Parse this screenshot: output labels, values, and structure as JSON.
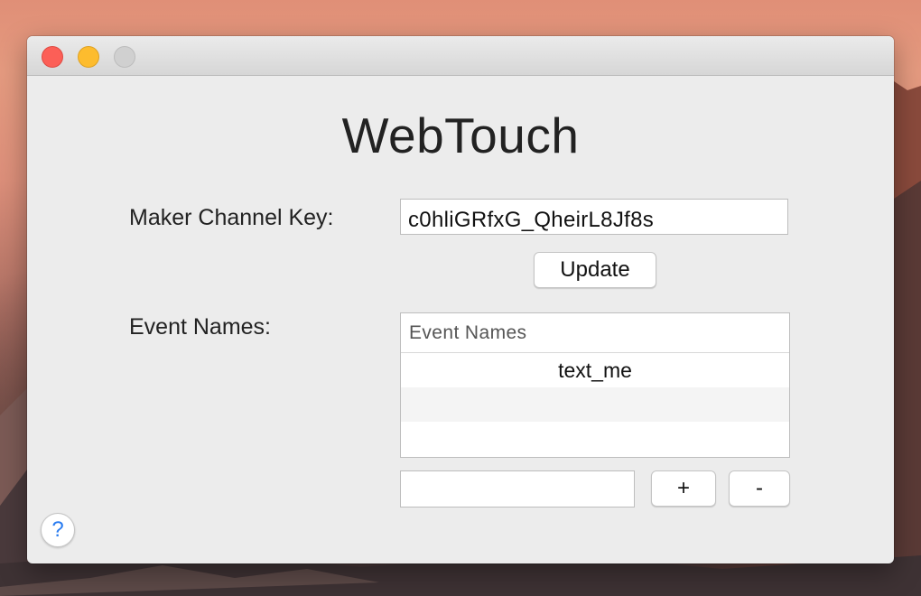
{
  "window": {
    "title": "WebTouch"
  },
  "form": {
    "maker_key_label": "Maker Channel Key:",
    "maker_key_value": "c0hliGRfxG_QheirL8Jf8s",
    "update_label": "Update",
    "event_names_label": "Event Names:"
  },
  "event_table": {
    "header": "Event Names",
    "rows": [
      "text_me",
      "",
      ""
    ]
  },
  "event_controls": {
    "new_event_value": "",
    "add_label": "+",
    "remove_label": "-"
  },
  "help": {
    "label": "?"
  },
  "colors": {
    "close": "#fc5f57",
    "minimize": "#fdbc2e",
    "zoom_disabled": "#d0d0d0",
    "help_accent": "#2a7cf0"
  },
  "icons": {
    "close": "close-icon",
    "minimize": "minimize-icon",
    "zoom": "zoom-icon",
    "help": "help-icon"
  }
}
